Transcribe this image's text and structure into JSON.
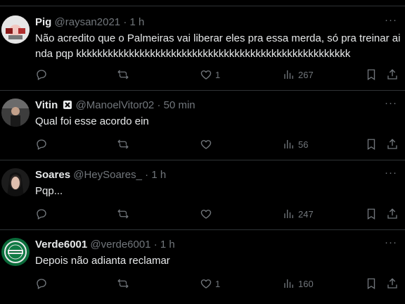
{
  "tweets": [
    {
      "name": "Pig",
      "handle": "@raysan2021",
      "time": "1 h",
      "text": "Não acredito que o Palmeiras vai liberar eles pra essa merda, só pra treinar ainda pqp kkkkkkkkkkkkkkkkkkkkkkkkkkkkkkkkkkkkkkkkkkkkkkkkkkkk",
      "likes": "1",
      "views": "267",
      "avatar_color": "#c9c9c9"
    },
    {
      "name": "Vitin",
      "handle": "@ManoelVitor02",
      "time": "50 min",
      "text": "Qual foi esse acordo ein",
      "likes": "",
      "views": "56",
      "avatar_color": "#3a3a3a"
    },
    {
      "name": "Soares",
      "handle": "@HeySoares_",
      "time": "1 h",
      "text": "Pqp...",
      "likes": "",
      "views": "247",
      "avatar_color": "#2a2a2a"
    },
    {
      "name": "Verde6001",
      "handle": "@verde6001",
      "time": "1 h",
      "text": "Depois não adianta reclamar",
      "likes": "1",
      "views": "160",
      "avatar_color": "#0b6b3a"
    }
  ],
  "separator": "·",
  "more_glyph": "···",
  "colors": {
    "background": "#000000",
    "text": "#e7e9ea",
    "muted": "#71767b",
    "divider": "#2f3336"
  }
}
